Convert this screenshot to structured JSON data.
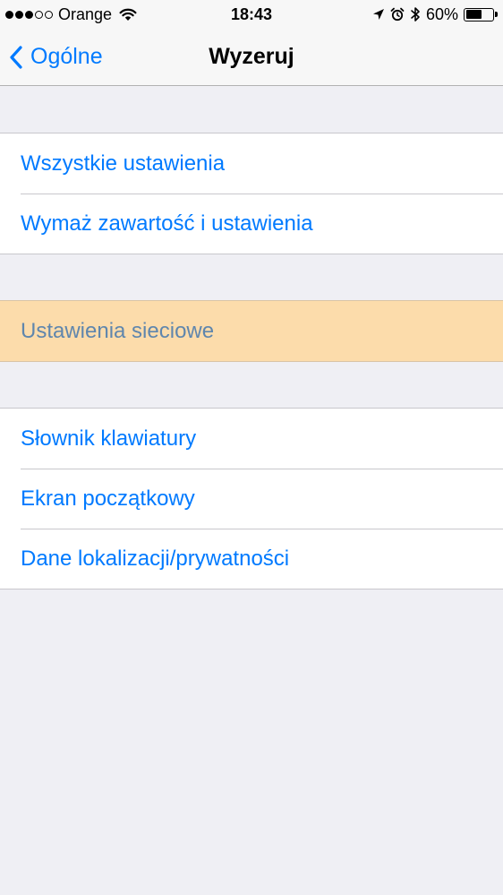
{
  "status_bar": {
    "carrier": "Orange",
    "time": "18:43",
    "battery_percent": "60%",
    "battery_level": 0.6,
    "signal_bars_filled": 3,
    "signal_bars_total": 5
  },
  "nav": {
    "back_label": "Ogólne",
    "title": "Wyzeruj"
  },
  "groups": [
    {
      "items": [
        {
          "label": "Wszystkie ustawienia"
        },
        {
          "label": "Wymaż zawartość i ustawienia"
        }
      ]
    },
    {
      "items": [
        {
          "label": "Ustawienia sieciowe",
          "highlighted": true
        }
      ]
    },
    {
      "items": [
        {
          "label": "Słownik klawiatury"
        },
        {
          "label": "Ekran początkowy"
        },
        {
          "label": "Dane lokalizacji/prywatności"
        }
      ]
    }
  ],
  "colors": {
    "accent": "#007aff",
    "highlight": "#fcdcab",
    "background": "#efeff4"
  }
}
